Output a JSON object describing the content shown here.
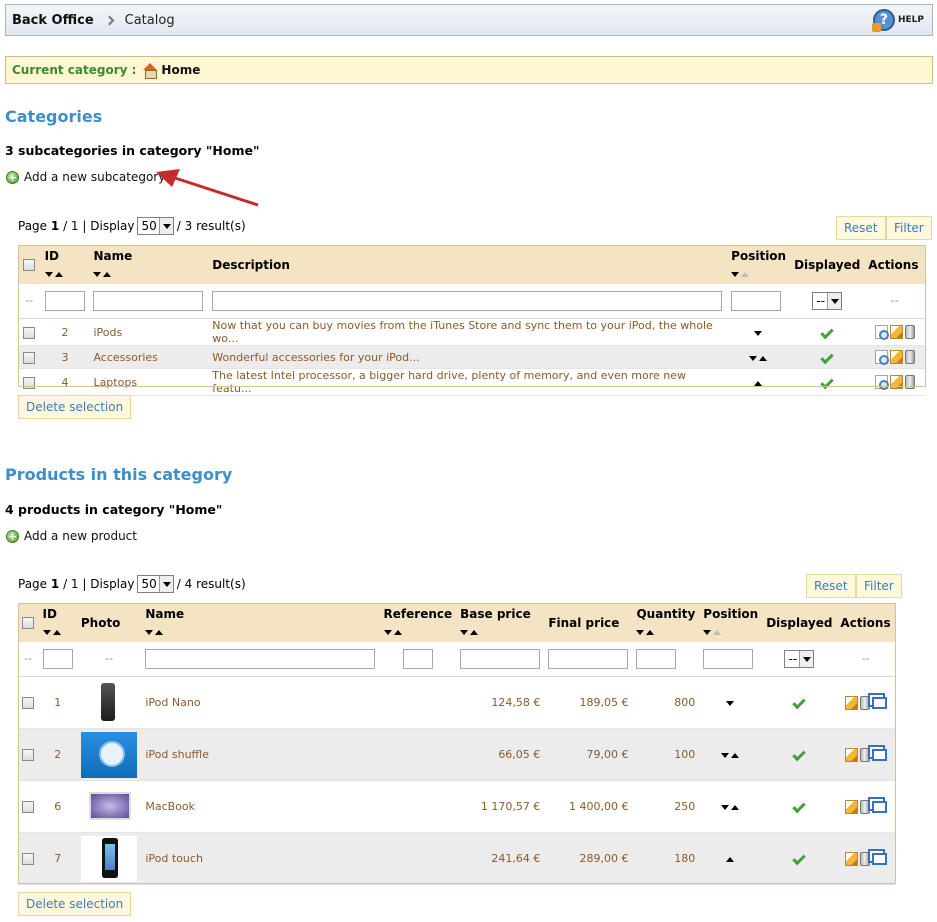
{
  "path": {
    "root": "Back Office",
    "current": "Catalog",
    "help": "HELP"
  },
  "current_category": {
    "label": "Current category :",
    "value": "Home"
  },
  "categories": {
    "heading": "Categories",
    "count": "3 subcategories in category \"Home\"",
    "add_label": "Add a new subcategory",
    "pager": {
      "page": "Page",
      "current": "1",
      "total": "/ 1 | Display",
      "per_page": "50",
      "results": "/ 3 result(s)"
    },
    "reset": "Reset",
    "filter": "Filter",
    "columns": {
      "id": "ID",
      "name": "Name",
      "description": "Description",
      "position": "Position",
      "displayed": "Displayed",
      "actions": "Actions"
    },
    "filter_dash": "--",
    "displayed_select": "--",
    "rows": [
      {
        "id": "2",
        "name": "iPods",
        "description": "Now that you can buy movies from the iTunes Store and sync them to your iPod, the whole wo..."
      },
      {
        "id": "3",
        "name": "Accessories",
        "description": "Wonderful accessories for your iPod..."
      },
      {
        "id": "4",
        "name": "Laptops",
        "description": "The latest Intel processor, a bigger hard drive, plenty of memory, and even more new featu..."
      }
    ],
    "delete": "Delete selection"
  },
  "products": {
    "heading": "Products in this category",
    "count": "4 products in category \"Home\"",
    "add_label": "Add a new product",
    "pager": {
      "page": "Page",
      "current": "1",
      "total": "/ 1 | Display",
      "per_page": "50",
      "results": "/ 4 result(s)"
    },
    "reset": "Reset",
    "filter": "Filter",
    "columns": {
      "id": "ID",
      "photo": "Photo",
      "name": "Name",
      "reference": "Reference",
      "base_price": "Base price",
      "final_price": "Final price",
      "quantity": "Quantity",
      "position": "Position",
      "displayed": "Displayed",
      "actions": "Actions"
    },
    "filter_dash": "--",
    "displayed_select": "--",
    "rows": [
      {
        "id": "1",
        "name": "iPod Nano",
        "base": "124,58 €",
        "final": "189,05 €",
        "qty": "800"
      },
      {
        "id": "2",
        "name": "iPod shuffle",
        "base": "66,05 €",
        "final": "79,00 €",
        "qty": "100"
      },
      {
        "id": "6",
        "name": "MacBook",
        "base": "1 170,57 €",
        "final": "1 400,00 €",
        "qty": "250"
      },
      {
        "id": "7",
        "name": "iPod touch",
        "base": "241,64 €",
        "final": "289,00 €",
        "qty": "180"
      }
    ],
    "delete": "Delete selection"
  },
  "colors": {
    "accent": "#3e8fc7",
    "header_bg": "#f5e4c3",
    "link_brown": "#8a5a2a",
    "arrow": "#c62a2a"
  }
}
